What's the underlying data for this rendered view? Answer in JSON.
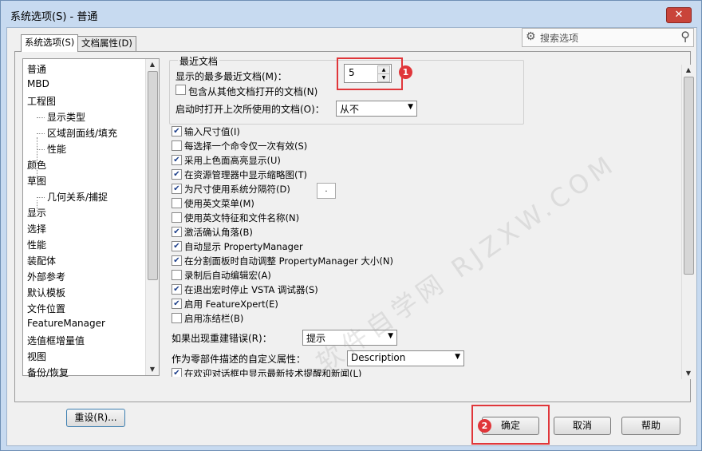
{
  "window": {
    "title": "系统选项(S) - 普通",
    "close_label": "✕"
  },
  "tabs": [
    "系统选项(S)",
    "文档属性(D)"
  ],
  "search": {
    "placeholder": "搜索选项",
    "gear_icon": "gear-icon",
    "magnifier_icon": "search-icon"
  },
  "tree": {
    "items": [
      {
        "label": "普通",
        "level": 0
      },
      {
        "label": "MBD",
        "level": 0
      },
      {
        "label": "工程图",
        "level": 0
      },
      {
        "label": "显示类型",
        "level": 1
      },
      {
        "label": "区域剖面线/填充",
        "level": 1
      },
      {
        "label": "性能",
        "level": 1
      },
      {
        "label": "颜色",
        "level": 0
      },
      {
        "label": "草图",
        "level": 0
      },
      {
        "label": "几何关系/捕捉",
        "level": 1
      },
      {
        "label": "显示",
        "level": 0
      },
      {
        "label": "选择",
        "level": 0
      },
      {
        "label": "性能",
        "level": 0
      },
      {
        "label": "装配体",
        "level": 0
      },
      {
        "label": "外部参考",
        "level": 0
      },
      {
        "label": "默认模板",
        "level": 0
      },
      {
        "label": "文件位置",
        "level": 0
      },
      {
        "label": "FeatureManager",
        "level": 0
      },
      {
        "label": "选值框增量值",
        "level": 0
      },
      {
        "label": "视图",
        "level": 0
      },
      {
        "label": "备份/恢复",
        "level": 0
      }
    ]
  },
  "reset_label": "重设(R)...",
  "recent_docs": {
    "group_label": "最近文档",
    "max_label": "显示的最多最近文档(M)：",
    "max_value": "5",
    "include_label": "包含从其他文档打开的文档(N)",
    "include_checked": false,
    "open_on_start_label": "启动时打开上次所使用的文档(O)：",
    "open_on_start_value": "从不"
  },
  "checkboxes": [
    {
      "label": "输入尺寸值(I)",
      "checked": true
    },
    {
      "label": "每选择一个命令仅一次有效(S)",
      "checked": false
    },
    {
      "label": "采用上色面高亮显示(U)",
      "checked": true
    },
    {
      "label": "在资源管理器中显示缩略图(T)",
      "checked": true
    },
    {
      "label": "为尺寸使用系统分隔符(D)",
      "checked": true
    },
    {
      "label": "使用英文菜单(M)",
      "checked": false
    },
    {
      "label": "使用英文特征和文件名称(N)",
      "checked": false
    },
    {
      "label": "激活确认角落(B)",
      "checked": true
    },
    {
      "label": "自动显示 PropertyManager",
      "checked": true
    },
    {
      "label": "在分割面板时自动调整 PropertyManager 大小(N)",
      "checked": true
    },
    {
      "label": "录制后自动编辑宏(A)",
      "checked": false
    },
    {
      "label": "在退出宏时停止 VSTA 调试器(S)",
      "checked": true
    },
    {
      "label": "启用 FeatureXpert(E)",
      "checked": true
    },
    {
      "label": "启用冻结栏(B)",
      "checked": false
    }
  ],
  "separator_value": ".",
  "rebuild_error": {
    "label": "如果出现重建错误(R)：",
    "value": "提示"
  },
  "custom_prop": {
    "label": "作为零部件描述的自定义属性：",
    "value": "Description"
  },
  "last_check_label": "在欢迎对话框中显示最新技术提醒和新闻(L)",
  "last_check_checked": true,
  "callouts": [
    "1",
    "2"
  ],
  "watermark": "软件自学网 RJZXW.COM",
  "buttons": {
    "ok": "确定",
    "cancel": "取消",
    "help": "帮助"
  },
  "colors": {
    "highlight_red": "#e0363a",
    "frame_blue": "#c7daf0"
  }
}
